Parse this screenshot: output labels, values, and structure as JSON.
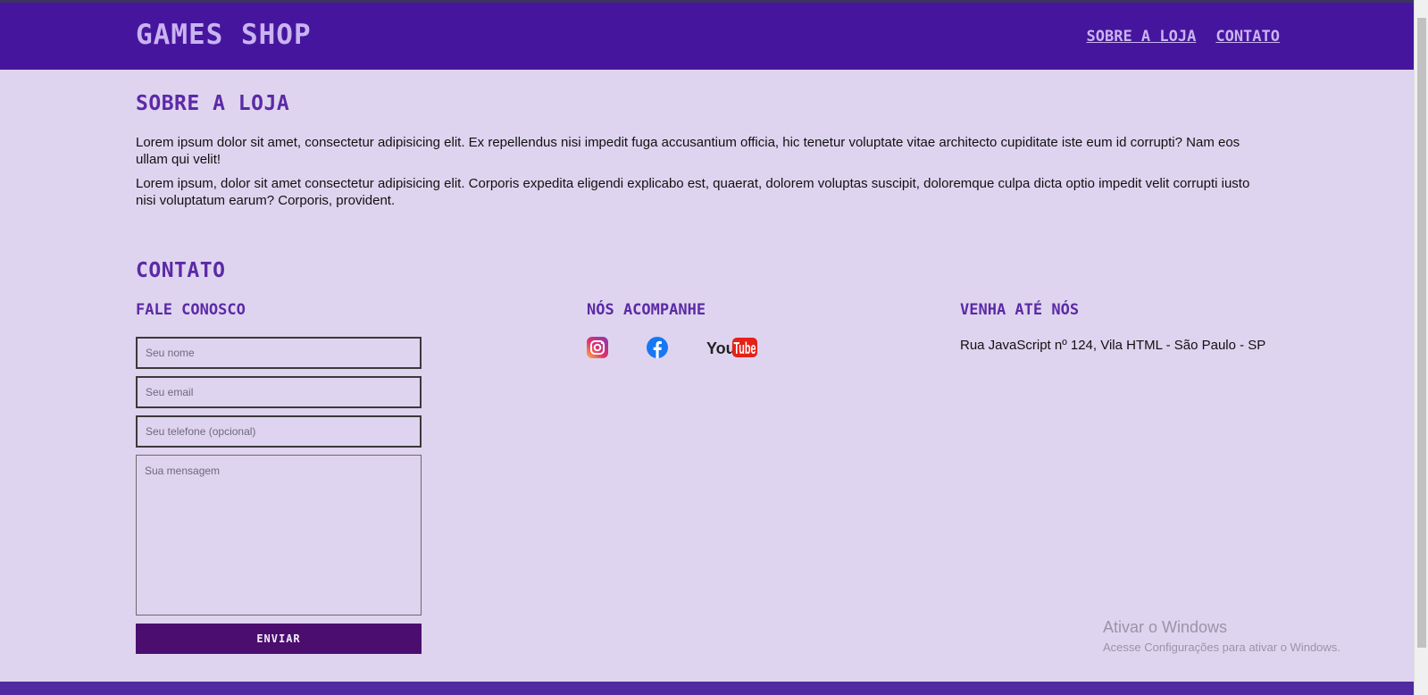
{
  "header": {
    "logo": "GAMES SHOP",
    "nav": [
      "SOBRE A LOJA",
      "CONTATO"
    ]
  },
  "about": {
    "title": "SOBRE A LOJA",
    "paragraphs": [
      "Lorem ipsum dolor sit amet, consectetur adipisicing elit. Ex repellendus nisi impedit fuga accusantium officia, hic tenetur voluptate vitae architecto cupiditate iste eum id corrupti? Nam eos ullam qui velit!",
      "Lorem ipsum, dolor sit amet consectetur adipisicing elit. Corporis expedita eligendi explicabo est, quaerat, dolorem voluptas suscipit, doloremque culpa dicta optio impedit velit corrupti iusto nisi voluptatum earum? Corporis, provident."
    ]
  },
  "contact": {
    "title": "CONTATO",
    "form": {
      "title": "FALE CONOSCO",
      "name_placeholder": "Seu nome",
      "email_placeholder": "Seu email",
      "phone_placeholder": "Seu telefone (opcional)",
      "message_placeholder": "Sua mensagem",
      "submit_label": "ENVIAR"
    },
    "social": {
      "title": "NÓS ACOMPANHE",
      "icons": [
        "instagram-icon",
        "facebook-icon",
        "youtube-icon"
      ],
      "youtube_label_you": "You",
      "youtube_label_tube": "Tube"
    },
    "visit": {
      "title": "VENHA ATÉ NÓS",
      "address": "Rua JavaScript nº 124, Vila HTML - São Paulo - SP"
    }
  },
  "watermark": {
    "line1": "Ativar o Windows",
    "line2": "Acesse Configurações para ativar o Windows."
  },
  "colors": {
    "header_bg": "#46159e",
    "page_bg": "#dfd4ef",
    "accent": "#5b2aa6",
    "button_bg": "#4b0e6e"
  }
}
